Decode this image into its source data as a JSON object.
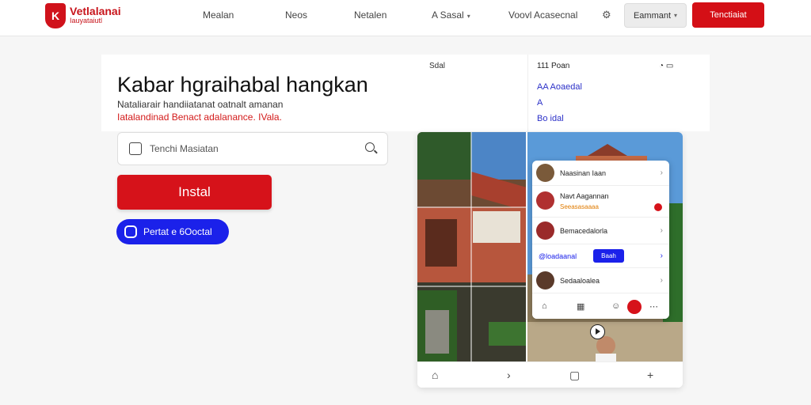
{
  "brand": {
    "name": "Vetlalanai",
    "tagline": "Iauyataiutl",
    "mark": "K"
  },
  "nav": {
    "links": [
      "Mealan",
      "Neos",
      "Netalen",
      "A Sasal",
      "Voovl Acasecnal"
    ],
    "grey_button": "Eammant",
    "red_button": "Tenctiaiat"
  },
  "hero": {
    "title": "Kabar hgraihabal hangkan",
    "sub1": "Nataliarair handiiatanat oatnalt amanan",
    "sub2": "Iatalandinad Benact adalanance. IVala.",
    "label_top": "Sdal"
  },
  "search": {
    "placeholder": "Tenchi Masiatan"
  },
  "buttons": {
    "install": "Instal",
    "pill": "Pertat e 6Ooctal"
  },
  "phone": {
    "time": "111 Poan",
    "line1": "AA Aoaedal",
    "line2": "A",
    "line3": "Bo idal"
  },
  "chats": [
    {
      "name": "Naasinan Iaan",
      "sub": ""
    },
    {
      "name": "Navt Aagannan",
      "sub": "Seeasasaaaa"
    },
    {
      "name": "Bemacedalorla",
      "sub": ""
    },
    {
      "name": "@loadaanal",
      "sub": "",
      "button": "Baah"
    },
    {
      "name": "Sedaaloalea",
      "sub": ""
    }
  ],
  "colors": {
    "brand_red": "#d40f16",
    "accent_blue": "#1b21ea"
  }
}
